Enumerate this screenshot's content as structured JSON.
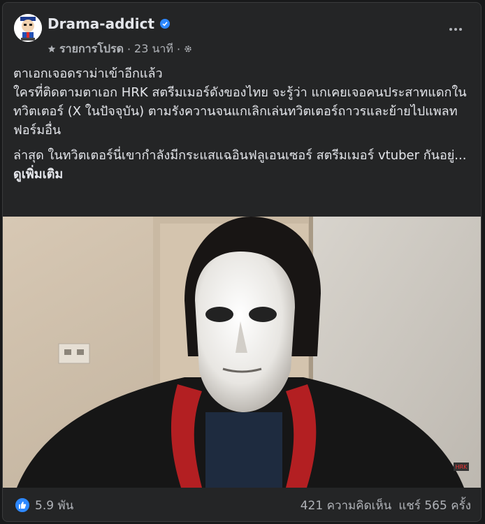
{
  "post": {
    "author": "Drama-addict",
    "verified": true,
    "audience": "รายการโปรด",
    "time": "23 นาที",
    "separator": "·",
    "paragraph1": "ตาเอกเจอดราม่าเข้าอีกแล้ว\nใครที่ติดตามตาเอก HRK สตรีมเมอร์ดังของไทย จะรู้ว่า แกเคยเจอคนประสาทแดกในทวิตเตอร์ (X ในปัจจุบัน) ตามรังควานจนแกเลิกเล่นทวิตเตอร์ถาวรและย้ายไปแพลทฟอร์มอื่น",
    "paragraph2": "ล่าสุด ในทวิตเตอร์นี่เขากำลังมีกระแสแฉอินฟลูเอนเซอร์ สตรีมเมอร์ vtuber กันอยู่... ",
    "see_more": "ดูเพิ่มเติม",
    "watermark": "HRK"
  },
  "stats": {
    "reactions": "5.9 พัน",
    "comments": "421 ความคิดเห็น",
    "shares": "แชร์ 565 ครั้ง"
  },
  "colors": {
    "background": "#242526",
    "accent": "#2d88ff",
    "text": "#e4e6eb",
    "muted": "#b0b3b8"
  },
  "icons": {
    "verified": "verified-badge-icon",
    "favorites": "star-icon",
    "privacy": "gear-icon",
    "more": "more-dots-icon",
    "like": "thumbs-up-icon"
  }
}
